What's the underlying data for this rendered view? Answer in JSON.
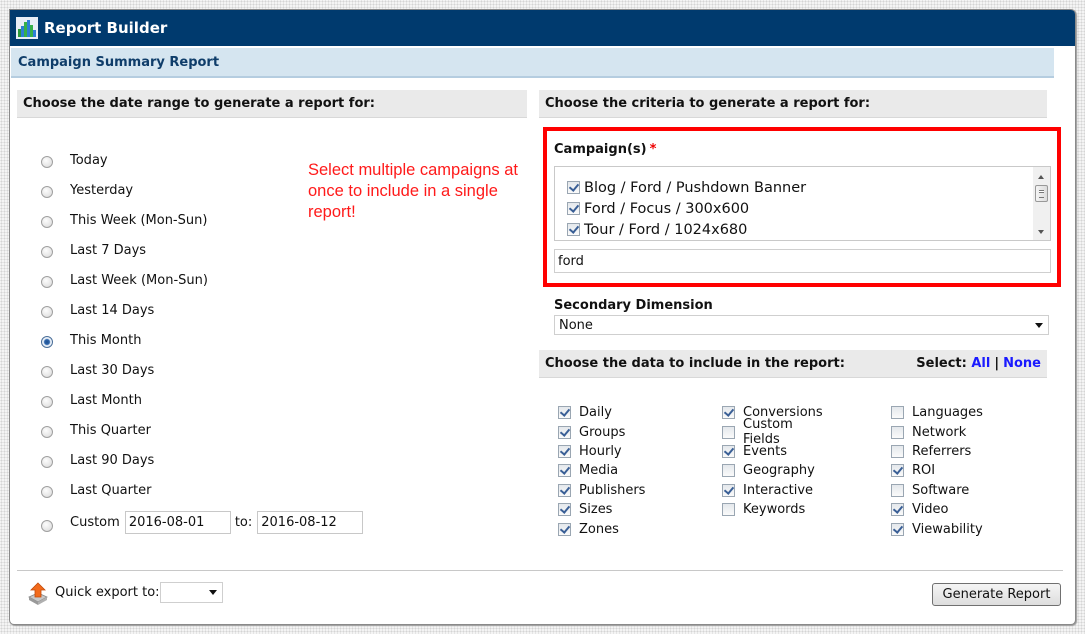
{
  "window": {
    "title": "Report Builder",
    "icon": "bar-chart-icon"
  },
  "report": {
    "name": "Campaign Summary Report"
  },
  "date_range": {
    "heading": "Choose the date range to generate a report for:",
    "options": [
      {
        "label": "Today",
        "checked": false
      },
      {
        "label": "Yesterday",
        "checked": false
      },
      {
        "label": "This Week (Mon-Sun)",
        "checked": false
      },
      {
        "label": "Last 7 Days",
        "checked": false
      },
      {
        "label": "Last Week (Mon-Sun)",
        "checked": false
      },
      {
        "label": "Last 14 Days",
        "checked": false
      },
      {
        "label": "This Month",
        "checked": true
      },
      {
        "label": "Last 30 Days",
        "checked": false
      },
      {
        "label": "Last Month",
        "checked": false
      },
      {
        "label": "This Quarter",
        "checked": false
      },
      {
        "label": "Last 90 Days",
        "checked": false
      },
      {
        "label": "Last Quarter",
        "checked": false
      }
    ],
    "custom": {
      "label": "Custom",
      "from": "2016-08-01",
      "to_label": "to:",
      "to": "2016-08-12",
      "checked": false
    }
  },
  "annotation": {
    "text": "Select multiple campaigns at once to include in a single report!",
    "color": "#ff1a1a"
  },
  "criteria": {
    "heading": "Choose the criteria to generate a report for:",
    "campaigns_label": "Campaign(s)",
    "required_marker": "*",
    "campaigns": [
      {
        "label": "Blog / Ford / Pushdown Banner",
        "checked": true
      },
      {
        "label": "Ford / Focus / 300x600",
        "checked": true
      },
      {
        "label": "Tour / Ford / 1024x680",
        "checked": true
      }
    ],
    "filter_value": "ford",
    "secondary_dimension_label": "Secondary Dimension",
    "secondary_dimension_value": "None"
  },
  "data_selection": {
    "heading": "Choose the data to include in the report:",
    "select_label": "Select:",
    "select_all": "All",
    "select_separator": "|",
    "select_none": "None",
    "columns": [
      [
        {
          "label": "Daily",
          "checked": true
        },
        {
          "label": "Groups",
          "checked": true
        },
        {
          "label": "Hourly",
          "checked": true
        },
        {
          "label": "Media",
          "checked": true
        },
        {
          "label": "Publishers",
          "checked": true
        },
        {
          "label": "Sizes",
          "checked": true
        },
        {
          "label": "Zones",
          "checked": true
        }
      ],
      [
        {
          "label": "Conversions",
          "checked": true
        },
        {
          "label": "Custom Fields",
          "checked": false
        },
        {
          "label": "Events",
          "checked": true
        },
        {
          "label": "Geography",
          "checked": false
        },
        {
          "label": "Interactive",
          "checked": true
        },
        {
          "label": "Keywords",
          "checked": false
        }
      ],
      [
        {
          "label": "Languages",
          "checked": false
        },
        {
          "label": "Network",
          "checked": false
        },
        {
          "label": "Referrers",
          "checked": false
        },
        {
          "label": "ROI",
          "checked": true
        },
        {
          "label": "Software",
          "checked": false
        },
        {
          "label": "Video",
          "checked": true
        },
        {
          "label": "Viewability",
          "checked": true
        }
      ]
    ]
  },
  "footer": {
    "quick_export_label": "Quick export to:",
    "quick_export_value": "",
    "generate_button": "Generate Report"
  },
  "colors": {
    "titlebar": "#003a6e",
    "highlight": "#ff0000",
    "link": "#1a1aff"
  }
}
